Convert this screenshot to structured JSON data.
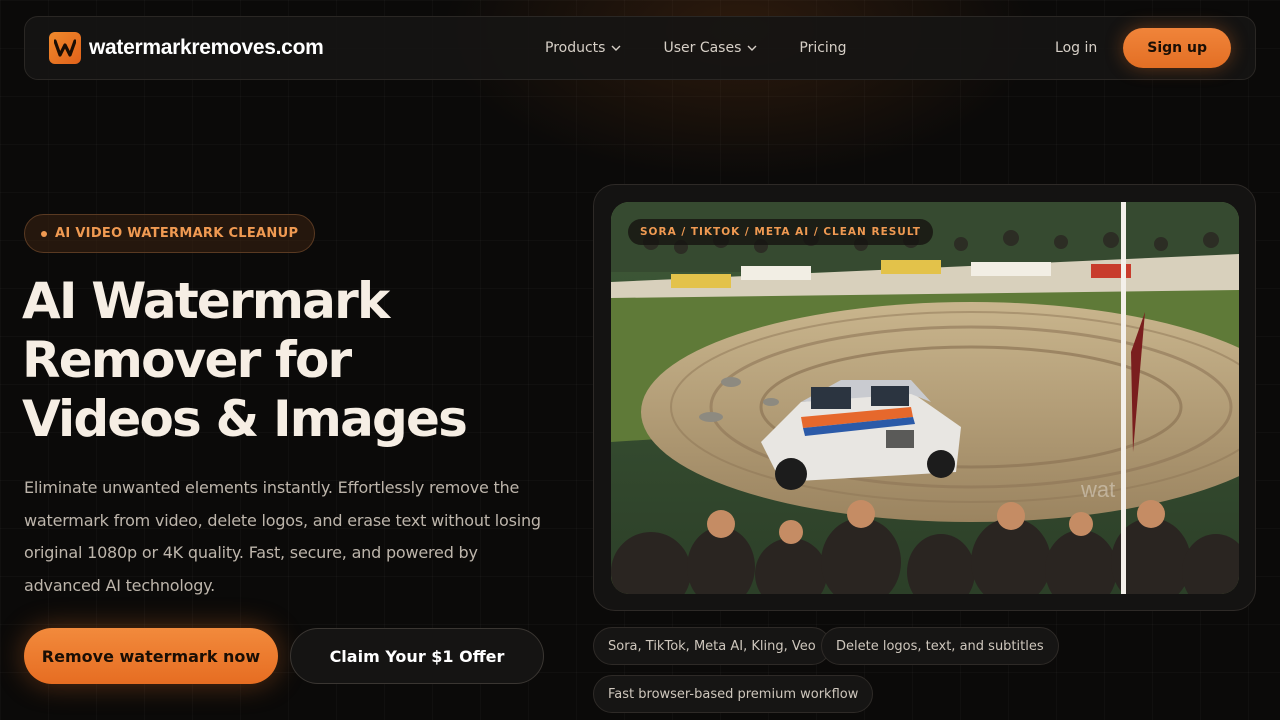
{
  "nav": {
    "brand": "watermarkremoves.com",
    "links": [
      {
        "label": "Products",
        "has_dropdown": true
      },
      {
        "label": "User Cases",
        "has_dropdown": true
      },
      {
        "label": "Pricing",
        "has_dropdown": false
      }
    ],
    "login_label": "Log in",
    "signup_label": "Sign up"
  },
  "hero": {
    "badge": "AI VIDEO WATERMARK CLEANUP",
    "title_lines": [
      "AI Watermark",
      "Remover for",
      "Videos & Images"
    ],
    "description": "Eliminate unwanted elements instantly. Effortlessly remove the watermark from video, delete logos, and erase text without losing original 1080p or 4K quality. Fast, secure, and powered by advanced AI technology.",
    "primary_cta": "Remove watermark now",
    "secondary_cta": "Claim Your $1 Offer"
  },
  "preview": {
    "label": "SORA / TIKTOK / META AI / CLEAN RESULT",
    "watermark_text": "wat"
  },
  "feature_pills": [
    "Sora, TikTok, Meta AI, Kling, Veo",
    "Delete logos, text, and subtitles",
    "Fast browser-based premium workflow"
  ],
  "colors": {
    "accent": "#ee7a2e",
    "background": "#0b0a09",
    "text": "#f6eee4"
  }
}
